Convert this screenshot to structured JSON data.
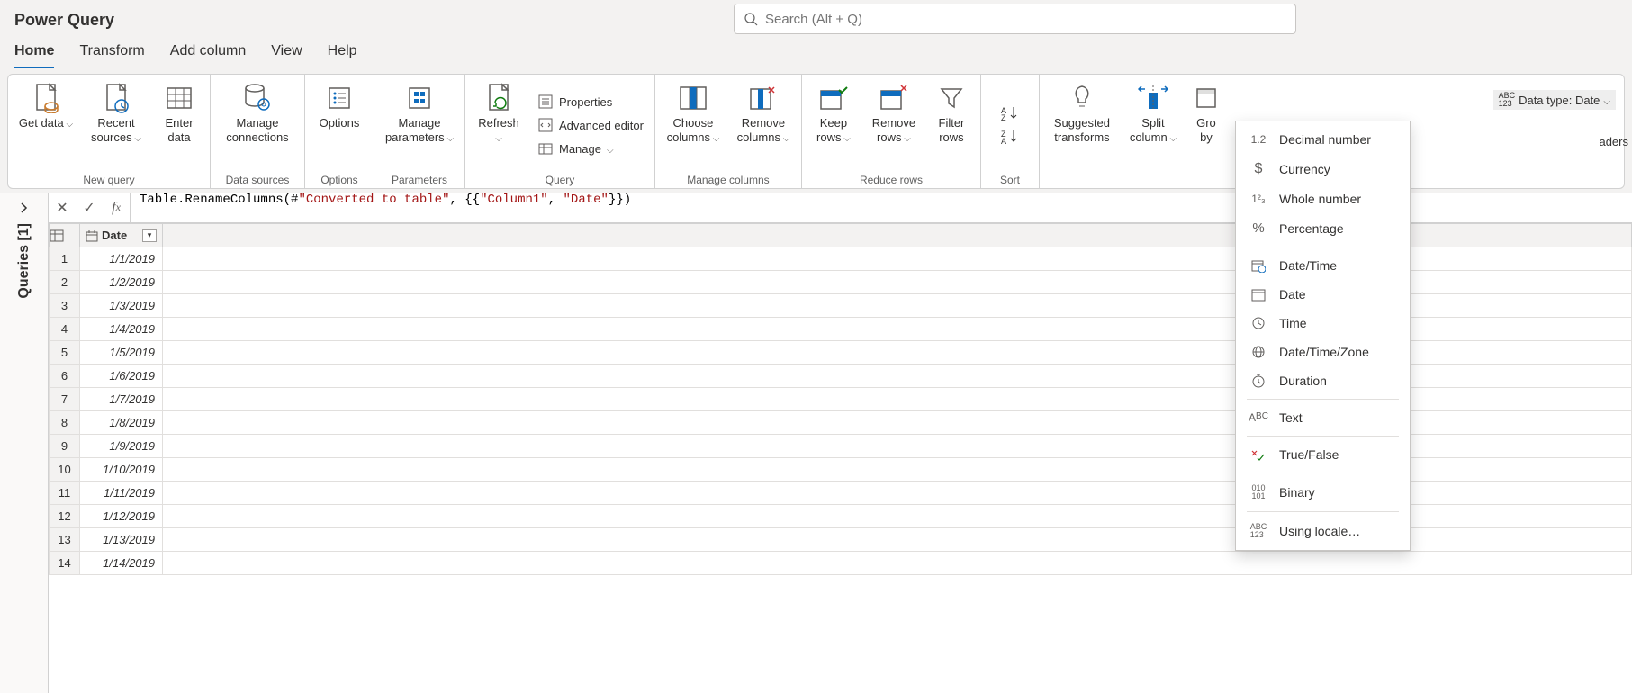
{
  "app_title": "Power Query",
  "search": {
    "placeholder": "Search (Alt + Q)"
  },
  "tabs": [
    "Home",
    "Transform",
    "Add column",
    "View",
    "Help"
  ],
  "ribbon": {
    "new_query": {
      "label": "New query",
      "get_data": "Get data",
      "recent_sources": "Recent sources",
      "enter_data": "Enter data"
    },
    "data_sources": {
      "label": "Data sources",
      "manage_connections": "Manage connections"
    },
    "options": {
      "label": "Options",
      "options": "Options"
    },
    "parameters": {
      "label": "Parameters",
      "manage_parameters": "Manage parameters"
    },
    "query": {
      "label": "Query",
      "refresh": "Refresh",
      "properties": "Properties",
      "advanced_editor": "Advanced editor",
      "manage": "Manage"
    },
    "manage_columns": {
      "label": "Manage columns",
      "choose_columns": "Choose columns",
      "remove_columns": "Remove columns"
    },
    "reduce_rows": {
      "label": "Reduce rows",
      "keep_rows": "Keep rows",
      "remove_rows": "Remove rows",
      "filter_rows": "Filter rows"
    },
    "sort": {
      "label": "Sort"
    },
    "transform": {
      "suggested": "Suggested transforms",
      "split_column": "Split column",
      "group_by": "Group by",
      "data_type_label": "Data type: Date"
    },
    "overflow": "aders"
  },
  "queries_pane": {
    "label": "Queries [1]"
  },
  "formula": {
    "prefix": "Table.RenameColumns(#",
    "str1": "\"Converted to table\"",
    "mid": ", {{",
    "str2": "\"Column1\"",
    "comma": ", ",
    "str3": "\"Date\"",
    "suffix": "}})"
  },
  "grid": {
    "column": "Date",
    "rows": [
      {
        "n": 1,
        "v": "1/1/2019"
      },
      {
        "n": 2,
        "v": "1/2/2019"
      },
      {
        "n": 3,
        "v": "1/3/2019"
      },
      {
        "n": 4,
        "v": "1/4/2019"
      },
      {
        "n": 5,
        "v": "1/5/2019"
      },
      {
        "n": 6,
        "v": "1/6/2019"
      },
      {
        "n": 7,
        "v": "1/7/2019"
      },
      {
        "n": 8,
        "v": "1/8/2019"
      },
      {
        "n": 9,
        "v": "1/9/2019"
      },
      {
        "n": 10,
        "v": "1/10/2019"
      },
      {
        "n": 11,
        "v": "1/11/2019"
      },
      {
        "n": 12,
        "v": "1/12/2019"
      },
      {
        "n": 13,
        "v": "1/13/2019"
      },
      {
        "n": 14,
        "v": "1/14/2019"
      }
    ]
  },
  "datatype_menu": {
    "decimal": "Decimal number",
    "currency": "Currency",
    "whole": "Whole number",
    "percentage": "Percentage",
    "datetime": "Date/Time",
    "date": "Date",
    "time": "Time",
    "dtz": "Date/Time/Zone",
    "duration": "Duration",
    "text": "Text",
    "bool": "True/False",
    "binary": "Binary",
    "locale": "Using locale…"
  }
}
